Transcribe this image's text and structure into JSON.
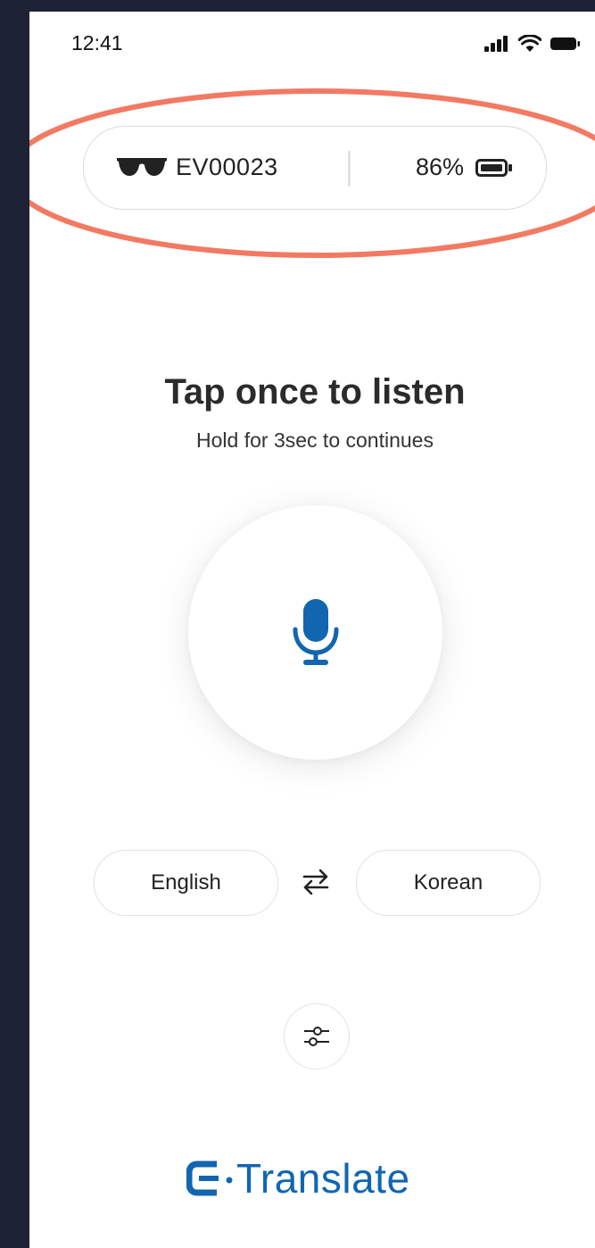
{
  "status_bar": {
    "time": "12:41",
    "icons": [
      "cellular-signal-icon",
      "wifi-icon",
      "battery-icon"
    ]
  },
  "device": {
    "icon": "sunglasses-icon",
    "id": "EV00023",
    "battery_percent": "86%",
    "battery_icon": "battery-icon"
  },
  "main": {
    "headline": "Tap once to listen",
    "subline": "Hold for 3sec to continues",
    "mic_icon": "microphone-icon"
  },
  "languages": {
    "source": "English",
    "target": "Korean",
    "swap_icon": "swap-arrows-icon"
  },
  "settings": {
    "icon": "sliders-icon"
  },
  "brand": {
    "name": "Translate",
    "logo_icon": "e-logo-icon"
  },
  "colors": {
    "accent": "#1266b0",
    "highlight": "#f27a63",
    "frame": "#1e2235"
  }
}
